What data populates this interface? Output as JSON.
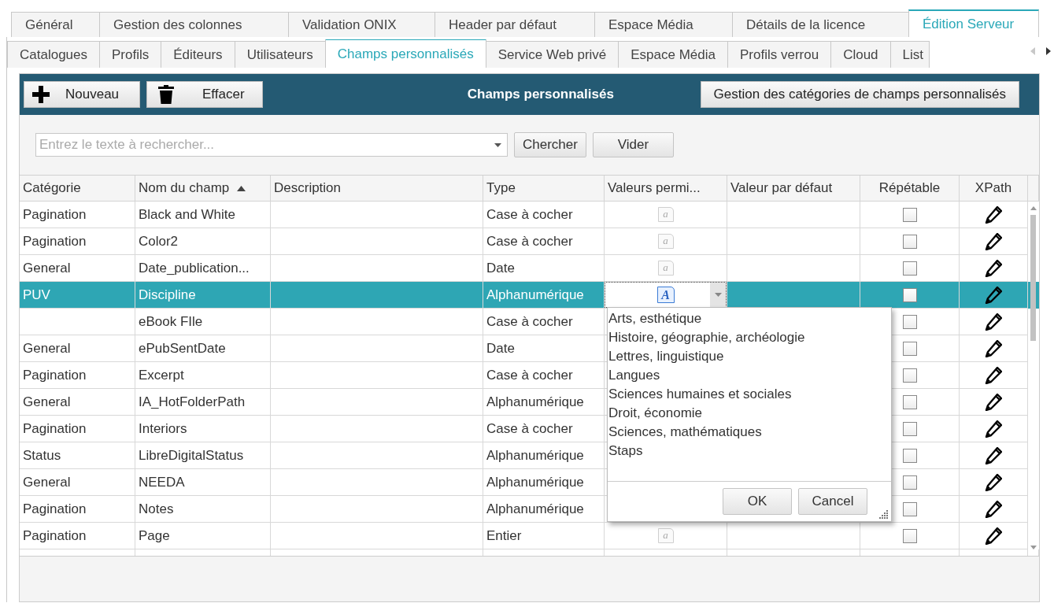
{
  "top_tabs": [
    {
      "label": "Général",
      "selected": false
    },
    {
      "label": "Gestion des colonnes",
      "selected": false
    },
    {
      "label": "Validation ONIX",
      "selected": false
    },
    {
      "label": "Header par défaut",
      "selected": false
    },
    {
      "label": "Espace Média",
      "selected": false
    },
    {
      "label": "Détails de la licence",
      "selected": false
    },
    {
      "label": "Édition Serveur",
      "selected": true
    }
  ],
  "sub_tabs": [
    {
      "label": "Catalogues",
      "selected": false
    },
    {
      "label": "Profils",
      "selected": false
    },
    {
      "label": "Éditeurs",
      "selected": false
    },
    {
      "label": "Utilisateurs",
      "selected": false
    },
    {
      "label": "Champs personnalisés",
      "selected": true
    },
    {
      "label": "Service Web privé",
      "selected": false
    },
    {
      "label": "Espace Média",
      "selected": false
    },
    {
      "label": "Profils verrou",
      "selected": false
    },
    {
      "label": "Cloud",
      "selected": false
    },
    {
      "label": "List",
      "selected": false
    }
  ],
  "toolbar": {
    "new_button": "Nouveau",
    "delete_button": "Effacer",
    "title": "Champs personnalisés",
    "categories_button": "Gestion des catégories de champs personnalisés"
  },
  "search": {
    "placeholder": "Entrez le texte à rechercher...",
    "search_button": "Chercher",
    "clear_button": "Vider"
  },
  "table": {
    "columns": [
      {
        "label": "Catégorie",
        "sorted": false
      },
      {
        "label": "Nom du champ",
        "sorted": true
      },
      {
        "label": "Description",
        "sorted": false
      },
      {
        "label": "Type",
        "sorted": false
      },
      {
        "label": "Valeurs permi...",
        "sorted": false
      },
      {
        "label": "Valeur par défaut",
        "sorted": false
      },
      {
        "label": "Répétable",
        "sorted": false
      },
      {
        "label": "XPath",
        "sorted": false
      }
    ],
    "rows": [
      {
        "category": "Pagination",
        "name": "Black and White",
        "type": "Case à cocher",
        "values_icon": "a",
        "editing": false,
        "repeatable": false,
        "selected": false
      },
      {
        "category": "Pagination",
        "name": "Color2",
        "type": "Case à cocher",
        "values_icon": "a",
        "editing": false,
        "repeatable": false,
        "selected": false
      },
      {
        "category": "General",
        "name": "Date_publication...",
        "type": "Date",
        "values_icon": "a",
        "editing": false,
        "repeatable": false,
        "selected": false
      },
      {
        "category": "PUV",
        "name": "Discipline",
        "type": "Alphanumérique",
        "values_icon": "A",
        "editing": true,
        "repeatable": false,
        "selected": true
      },
      {
        "category": "",
        "name": "eBook FIle",
        "type": "Case à cocher",
        "editing": false,
        "repeatable": false,
        "selected": false
      },
      {
        "category": "General",
        "name": "ePubSentDate",
        "type": "Date",
        "editing": false,
        "repeatable": false,
        "selected": false
      },
      {
        "category": "Pagination",
        "name": "Excerpt",
        "type": "Case à cocher",
        "editing": false,
        "repeatable": false,
        "selected": false
      },
      {
        "category": "General",
        "name": "IA_HotFolderPath",
        "type": "Alphanumérique",
        "editing": false,
        "repeatable": false,
        "selected": false
      },
      {
        "category": "Pagination",
        "name": "Interiors",
        "type": "Case à cocher",
        "editing": false,
        "repeatable": false,
        "selected": false
      },
      {
        "category": "Status",
        "name": "LibreDigitalStatus",
        "type": "Alphanumérique",
        "editing": false,
        "repeatable": false,
        "selected": false
      },
      {
        "category": "General",
        "name": "NEEDA",
        "type": "Alphanumérique",
        "editing": false,
        "repeatable": false,
        "selected": false
      },
      {
        "category": "Pagination",
        "name": "Notes",
        "type": "Alphanumérique",
        "editing": false,
        "repeatable": false,
        "selected": false
      },
      {
        "category": "Pagination",
        "name": "Page",
        "type": "Entier",
        "values_icon": "a",
        "editing": false,
        "repeatable": false,
        "selected": false
      }
    ]
  },
  "values_popup": {
    "items": [
      "Arts, esthétique",
      "Histoire, géographie, archéologie",
      "Lettres, linguistique",
      "Langues",
      "Sciences humaines et sociales",
      "Droit, économie",
      "Sciences, mathématiques",
      "Staps"
    ],
    "ok_button": "OK",
    "cancel_button": "Cancel"
  }
}
